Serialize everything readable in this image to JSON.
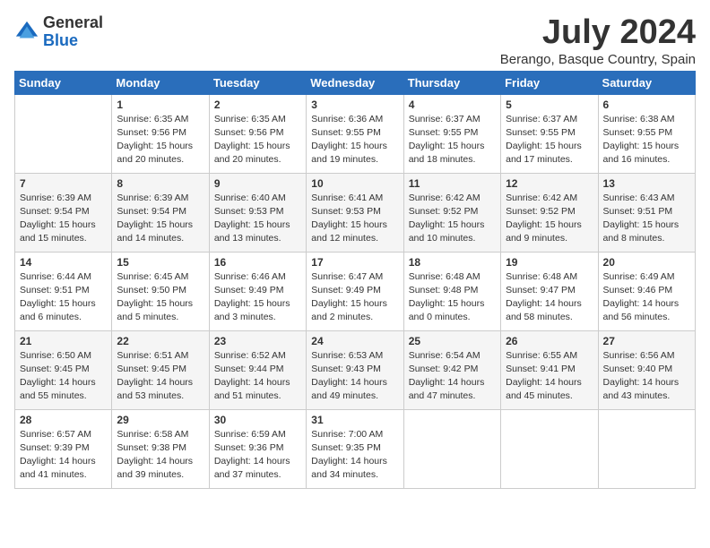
{
  "header": {
    "logo_general": "General",
    "logo_blue": "Blue",
    "month_title": "July 2024",
    "location": "Berango, Basque Country, Spain"
  },
  "weekdays": [
    "Sunday",
    "Monday",
    "Tuesday",
    "Wednesday",
    "Thursday",
    "Friday",
    "Saturday"
  ],
  "weeks": [
    [
      {
        "day": "",
        "sunrise": "",
        "sunset": "",
        "daylight": ""
      },
      {
        "day": "1",
        "sunrise": "Sunrise: 6:35 AM",
        "sunset": "Sunset: 9:56 PM",
        "daylight": "Daylight: 15 hours and 20 minutes."
      },
      {
        "day": "2",
        "sunrise": "Sunrise: 6:35 AM",
        "sunset": "Sunset: 9:56 PM",
        "daylight": "Daylight: 15 hours and 20 minutes."
      },
      {
        "day": "3",
        "sunrise": "Sunrise: 6:36 AM",
        "sunset": "Sunset: 9:55 PM",
        "daylight": "Daylight: 15 hours and 19 minutes."
      },
      {
        "day": "4",
        "sunrise": "Sunrise: 6:37 AM",
        "sunset": "Sunset: 9:55 PM",
        "daylight": "Daylight: 15 hours and 18 minutes."
      },
      {
        "day": "5",
        "sunrise": "Sunrise: 6:37 AM",
        "sunset": "Sunset: 9:55 PM",
        "daylight": "Daylight: 15 hours and 17 minutes."
      },
      {
        "day": "6",
        "sunrise": "Sunrise: 6:38 AM",
        "sunset": "Sunset: 9:55 PM",
        "daylight": "Daylight: 15 hours and 16 minutes."
      }
    ],
    [
      {
        "day": "7",
        "sunrise": "Sunrise: 6:39 AM",
        "sunset": "Sunset: 9:54 PM",
        "daylight": "Daylight: 15 hours and 15 minutes."
      },
      {
        "day": "8",
        "sunrise": "Sunrise: 6:39 AM",
        "sunset": "Sunset: 9:54 PM",
        "daylight": "Daylight: 15 hours and 14 minutes."
      },
      {
        "day": "9",
        "sunrise": "Sunrise: 6:40 AM",
        "sunset": "Sunset: 9:53 PM",
        "daylight": "Daylight: 15 hours and 13 minutes."
      },
      {
        "day": "10",
        "sunrise": "Sunrise: 6:41 AM",
        "sunset": "Sunset: 9:53 PM",
        "daylight": "Daylight: 15 hours and 12 minutes."
      },
      {
        "day": "11",
        "sunrise": "Sunrise: 6:42 AM",
        "sunset": "Sunset: 9:52 PM",
        "daylight": "Daylight: 15 hours and 10 minutes."
      },
      {
        "day": "12",
        "sunrise": "Sunrise: 6:42 AM",
        "sunset": "Sunset: 9:52 PM",
        "daylight": "Daylight: 15 hours and 9 minutes."
      },
      {
        "day": "13",
        "sunrise": "Sunrise: 6:43 AM",
        "sunset": "Sunset: 9:51 PM",
        "daylight": "Daylight: 15 hours and 8 minutes."
      }
    ],
    [
      {
        "day": "14",
        "sunrise": "Sunrise: 6:44 AM",
        "sunset": "Sunset: 9:51 PM",
        "daylight": "Daylight: 15 hours and 6 minutes."
      },
      {
        "day": "15",
        "sunrise": "Sunrise: 6:45 AM",
        "sunset": "Sunset: 9:50 PM",
        "daylight": "Daylight: 15 hours and 5 minutes."
      },
      {
        "day": "16",
        "sunrise": "Sunrise: 6:46 AM",
        "sunset": "Sunset: 9:49 PM",
        "daylight": "Daylight: 15 hours and 3 minutes."
      },
      {
        "day": "17",
        "sunrise": "Sunrise: 6:47 AM",
        "sunset": "Sunset: 9:49 PM",
        "daylight": "Daylight: 15 hours and 2 minutes."
      },
      {
        "day": "18",
        "sunrise": "Sunrise: 6:48 AM",
        "sunset": "Sunset: 9:48 PM",
        "daylight": "Daylight: 15 hours and 0 minutes."
      },
      {
        "day": "19",
        "sunrise": "Sunrise: 6:48 AM",
        "sunset": "Sunset: 9:47 PM",
        "daylight": "Daylight: 14 hours and 58 minutes."
      },
      {
        "day": "20",
        "sunrise": "Sunrise: 6:49 AM",
        "sunset": "Sunset: 9:46 PM",
        "daylight": "Daylight: 14 hours and 56 minutes."
      }
    ],
    [
      {
        "day": "21",
        "sunrise": "Sunrise: 6:50 AM",
        "sunset": "Sunset: 9:45 PM",
        "daylight": "Daylight: 14 hours and 55 minutes."
      },
      {
        "day": "22",
        "sunrise": "Sunrise: 6:51 AM",
        "sunset": "Sunset: 9:45 PM",
        "daylight": "Daylight: 14 hours and 53 minutes."
      },
      {
        "day": "23",
        "sunrise": "Sunrise: 6:52 AM",
        "sunset": "Sunset: 9:44 PM",
        "daylight": "Daylight: 14 hours and 51 minutes."
      },
      {
        "day": "24",
        "sunrise": "Sunrise: 6:53 AM",
        "sunset": "Sunset: 9:43 PM",
        "daylight": "Daylight: 14 hours and 49 minutes."
      },
      {
        "day": "25",
        "sunrise": "Sunrise: 6:54 AM",
        "sunset": "Sunset: 9:42 PM",
        "daylight": "Daylight: 14 hours and 47 minutes."
      },
      {
        "day": "26",
        "sunrise": "Sunrise: 6:55 AM",
        "sunset": "Sunset: 9:41 PM",
        "daylight": "Daylight: 14 hours and 45 minutes."
      },
      {
        "day": "27",
        "sunrise": "Sunrise: 6:56 AM",
        "sunset": "Sunset: 9:40 PM",
        "daylight": "Daylight: 14 hours and 43 minutes."
      }
    ],
    [
      {
        "day": "28",
        "sunrise": "Sunrise: 6:57 AM",
        "sunset": "Sunset: 9:39 PM",
        "daylight": "Daylight: 14 hours and 41 minutes."
      },
      {
        "day": "29",
        "sunrise": "Sunrise: 6:58 AM",
        "sunset": "Sunset: 9:38 PM",
        "daylight": "Daylight: 14 hours and 39 minutes."
      },
      {
        "day": "30",
        "sunrise": "Sunrise: 6:59 AM",
        "sunset": "Sunset: 9:36 PM",
        "daylight": "Daylight: 14 hours and 37 minutes."
      },
      {
        "day": "31",
        "sunrise": "Sunrise: 7:00 AM",
        "sunset": "Sunset: 9:35 PM",
        "daylight": "Daylight: 14 hours and 34 minutes."
      },
      {
        "day": "",
        "sunrise": "",
        "sunset": "",
        "daylight": ""
      },
      {
        "day": "",
        "sunrise": "",
        "sunset": "",
        "daylight": ""
      },
      {
        "day": "",
        "sunrise": "",
        "sunset": "",
        "daylight": ""
      }
    ]
  ]
}
